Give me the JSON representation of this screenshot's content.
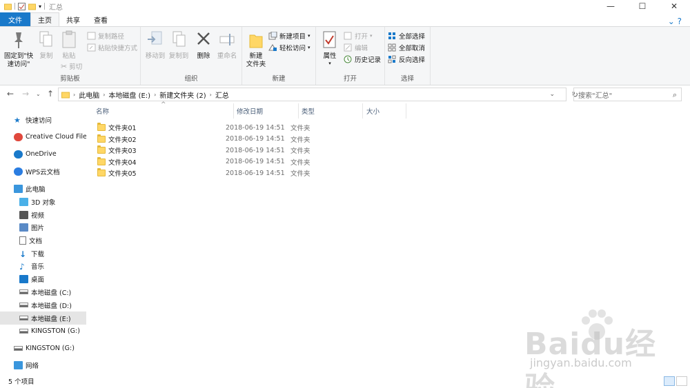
{
  "window": {
    "title": "汇总"
  },
  "tabs": [
    {
      "label": "文件"
    },
    {
      "label": "主页"
    },
    {
      "label": "共享"
    },
    {
      "label": "查看"
    }
  ],
  "ribbon": {
    "clipboard": {
      "label": "剪贴板",
      "pin": "固定到\"快\n速访问\"",
      "copy": "复制",
      "paste": "粘贴",
      "copy_path": "复制路径",
      "paste_shortcut": "粘贴快捷方式",
      "cut": "剪切"
    },
    "organize": {
      "label": "组织",
      "move_to": "移动到",
      "copy_to": "复制到",
      "delete": "删除",
      "rename": "重命名"
    },
    "new": {
      "label": "新建",
      "new_folder": "新建\n文件夹",
      "new_item": "新建项目",
      "easy_access": "轻松访问"
    },
    "open": {
      "label": "打开",
      "properties": "属性",
      "open": "打开",
      "edit": "编辑",
      "history": "历史记录"
    },
    "select": {
      "label": "选择",
      "select_all": "全部选择",
      "select_none": "全部取消",
      "invert": "反向选择"
    }
  },
  "address": {
    "crumbs": [
      "此电脑",
      "本地磁盘 (E:)",
      "新建文件夹 (2)",
      "汇总"
    ]
  },
  "search": {
    "placeholder": "搜索\"汇总\""
  },
  "nav": [
    {
      "label": "快速访问",
      "icon": "star-icon"
    },
    {
      "label": "Creative Cloud Files",
      "icon": "creative-cloud-icon"
    },
    {
      "label": "OneDrive",
      "icon": "cloud-icon"
    },
    {
      "label": "WPS云文档",
      "icon": "wps-cloud-icon"
    },
    {
      "label": "此电脑",
      "icon": "computer-icon"
    },
    {
      "label": "3D 对象",
      "icon": "cube-icon"
    },
    {
      "label": "视频",
      "icon": "video-icon"
    },
    {
      "label": "图片",
      "icon": "picture-icon"
    },
    {
      "label": "文档",
      "icon": "document-icon"
    },
    {
      "label": "下载",
      "icon": "download-icon"
    },
    {
      "label": "音乐",
      "icon": "music-icon"
    },
    {
      "label": "桌面",
      "icon": "desktop-icon"
    },
    {
      "label": "本地磁盘 (C:)",
      "icon": "drive-icon"
    },
    {
      "label": "本地磁盘 (D:)",
      "icon": "drive-icon"
    },
    {
      "label": "本地磁盘 (E:)",
      "icon": "drive-icon"
    },
    {
      "label": "KINGSTON (G:)",
      "icon": "usb-drive-icon"
    },
    {
      "label": "KINGSTON (G:)",
      "icon": "usb-drive-icon"
    },
    {
      "label": "网络",
      "icon": "network-icon"
    }
  ],
  "columns": {
    "name": "名称",
    "modified": "修改日期",
    "type": "类型",
    "size": "大小"
  },
  "files": [
    {
      "name": "文件夹01",
      "modified": "2018-06-19 14:51",
      "type": "文件夹"
    },
    {
      "name": "文件夹02",
      "modified": "2018-06-19 14:51",
      "type": "文件夹"
    },
    {
      "name": "文件夹03",
      "modified": "2018-06-19 14:51",
      "type": "文件夹"
    },
    {
      "name": "文件夹04",
      "modified": "2018-06-19 14:51",
      "type": "文件夹"
    },
    {
      "name": "文件夹05",
      "modified": "2018-06-19 14:51",
      "type": "文件夹"
    }
  ],
  "status": {
    "count": "5 个项目"
  },
  "watermark": {
    "logo": "Baidu经验",
    "url": "jingyan.baidu.com"
  },
  "colors": {
    "file_tab": "#1979ca",
    "folder": "#ffd766",
    "selection": "#cce8ff"
  }
}
